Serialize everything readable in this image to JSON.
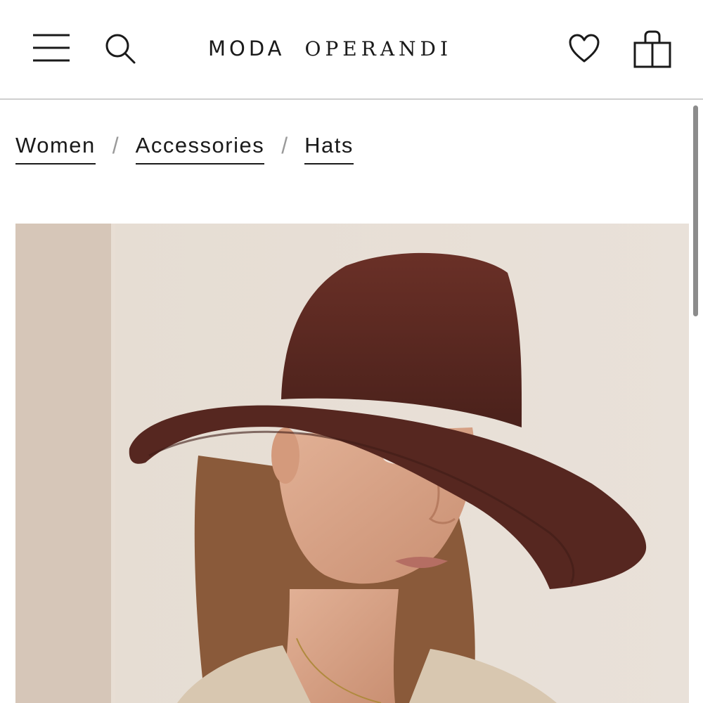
{
  "header": {
    "logo_left": "MODA",
    "logo_right": "OPERANDI",
    "icons": {
      "menu": "menu-icon",
      "search": "search-icon",
      "wishlist": "heart-icon",
      "bag": "shopping-bag-icon"
    }
  },
  "breadcrumb": {
    "items": [
      "Women",
      "Accessories",
      "Hats"
    ],
    "separator": "/"
  },
  "product": {
    "image_description_colors": {
      "wall": "#e2d7cd",
      "hat": "#5a2a22",
      "skin": "#d9a386",
      "hair": "#8a5a3a",
      "jacket": "#d8c7b0"
    }
  }
}
